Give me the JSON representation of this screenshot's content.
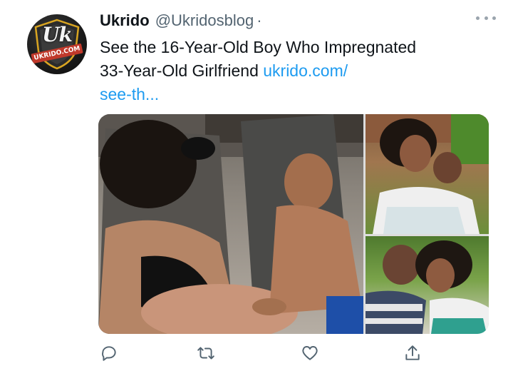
{
  "tweet": {
    "display_name": "Ukrido",
    "handle": "@Ukridosblog",
    "separator": "·",
    "text_line1": "See the 16-Year-Old Boy Who Impregnated",
    "text_line2": "33-Year-Old Girlfriend ",
    "link_part1": "ukrido.com/",
    "link_part2": "see-th...",
    "avatar_logo": "Uk",
    "avatar_caption": "UKRIDO.COM"
  },
  "media": {
    "photo_count": 3
  },
  "icons": {
    "more": "more-horizontal-icon",
    "reply": "reply-icon",
    "retweet": "retweet-icon",
    "like": "heart-icon",
    "share": "share-icon"
  },
  "colors": {
    "link": "#1d9bf0",
    "secondary_text": "#536471",
    "icon": "#536471"
  }
}
